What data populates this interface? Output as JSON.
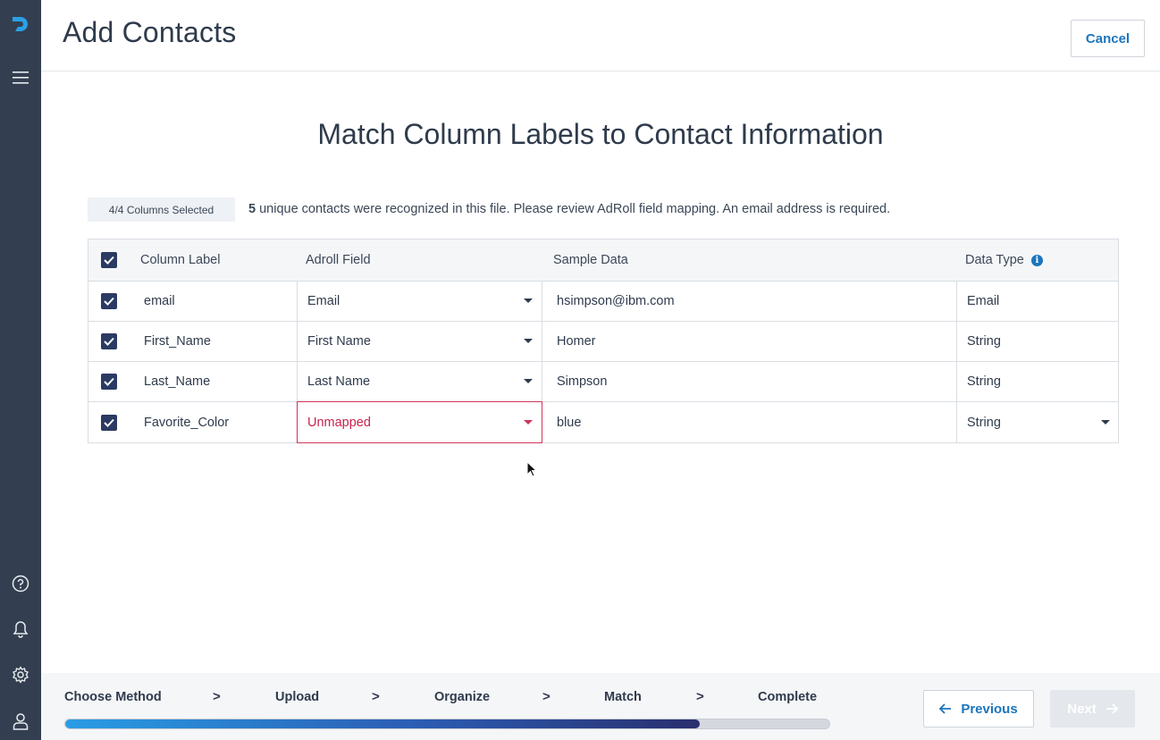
{
  "header": {
    "title": "Add Contacts",
    "cancel_label": "Cancel"
  },
  "main": {
    "heading": "Match Column Labels to Contact Information",
    "selection_badge": "4/4 Columns Selected",
    "summary_count": "5",
    "summary_text": " unique contacts were recognized in this file. Please review AdRoll field mapping. An email address is required."
  },
  "table": {
    "headers": {
      "label": "Column Label",
      "field": "Adroll Field",
      "sample": "Sample Data",
      "type": "Data Type"
    },
    "rows": [
      {
        "label": "email",
        "field": "Email",
        "sample": "hsimpson@ibm.com",
        "type": "Email",
        "checked": true
      },
      {
        "label": "First_Name",
        "field": "First Name",
        "sample": "Homer",
        "type": "String",
        "checked": true
      },
      {
        "label": "Last_Name",
        "field": "Last Name",
        "sample": "Simpson",
        "type": "String",
        "checked": true
      },
      {
        "label": "Favorite_Color",
        "field": "Unmapped",
        "sample": "blue",
        "type": "String",
        "checked": true
      }
    ]
  },
  "footer": {
    "steps": [
      "Choose Method",
      "Upload",
      "Organize",
      "Match",
      "Complete"
    ],
    "separator": ">",
    "progress_fraction": 0.83,
    "previous_label": "Previous",
    "next_label": "Next"
  },
  "colors": {
    "sidebar": "#333f50",
    "accent": "#1b75bc",
    "error": "#d0355a",
    "checkbox": "#2b3a63"
  },
  "icons": [
    "logo-icon",
    "menu-icon",
    "help-icon",
    "bell-icon",
    "gear-icon",
    "user-icon",
    "info-icon",
    "arrow-left-icon",
    "arrow-right-icon"
  ]
}
